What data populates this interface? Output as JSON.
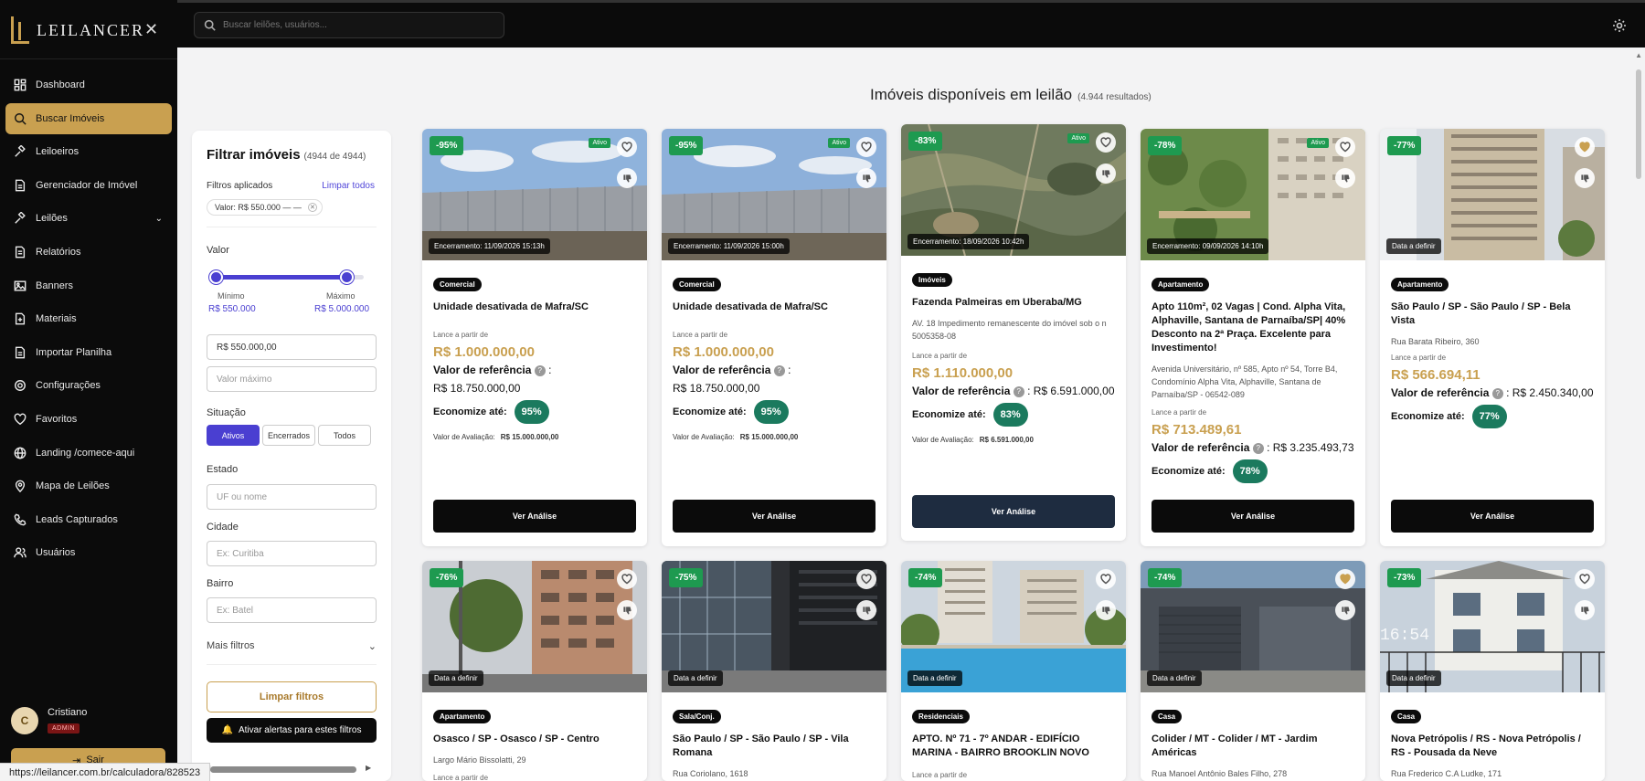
{
  "app": {
    "logo_text": "LEILANCER"
  },
  "nav": {
    "items": [
      {
        "label": "Dashboard"
      },
      {
        "label": "Buscar Imóveis"
      },
      {
        "label": "Leiloeiros"
      },
      {
        "label": "Gerenciador de Imóvel"
      },
      {
        "label": "Leilões"
      },
      {
        "label": "Relatórios"
      },
      {
        "label": "Banners"
      },
      {
        "label": "Materiais"
      },
      {
        "label": "Importar Planilha"
      },
      {
        "label": "Configurações"
      },
      {
        "label": "Favoritos"
      },
      {
        "label": "Landing /comece-aqui"
      },
      {
        "label": "Mapa de Leilões"
      },
      {
        "label": "Leads Capturados"
      },
      {
        "label": "Usuários"
      }
    ]
  },
  "user": {
    "initial": "C",
    "name": "Cristiano",
    "role": "ADMIN",
    "logout_label": "Sair"
  },
  "search": {
    "placeholder": "Buscar leilões, usuários..."
  },
  "main": {
    "title": "Imóveis disponíveis em leilão",
    "count": "(4.944 resultados)"
  },
  "filters": {
    "title": "Filtrar imóveis",
    "count": "(4944 de 4944)",
    "applied_label": "Filtros aplicados",
    "clear_all": "Limpar todos",
    "chip": "Valor: R$ 550.000 — —",
    "valor_label": "Valor",
    "min_caption": "Mínimo",
    "max_caption": "Máximo",
    "min_value": "R$ 550.000",
    "max_value": "R$ 5.000.000",
    "min_input": "R$ 550.000,00",
    "max_placeholder": "Valor máximo",
    "situacao_label": "Situação",
    "situacao_options": [
      "Ativos",
      "Encerrados",
      "Todos"
    ],
    "estado_label": "Estado",
    "estado_placeholder": "UF ou nome",
    "cidade_label": "Cidade",
    "cidade_placeholder": "Ex: Curitiba",
    "bairro_label": "Bairro",
    "bairro_placeholder": "Ex: Batel",
    "more_label": "Mais filtros",
    "clear_button": "Limpar filtros",
    "alerts_button": "Ativar alertas para estes filtros"
  },
  "labels": {
    "lance": "Lance a partir de",
    "ref": "Valor de referência",
    "eco": "Economize até:",
    "aval": "Valor de Avaliação:",
    "ver": "Ver Análise",
    "ativo": "Ativo"
  },
  "cards": [
    {
      "discount": "-95%",
      "active": true,
      "closing": "Encerramento: 11/09/2026 15:13h",
      "tag": "Comercial",
      "title": "Unidade desativada de Mafra/SC",
      "address": "",
      "price": "R$ 1.000.000,00",
      "ref_value": "R$ 18.750.000,00",
      "eco": "95%",
      "aval": "R$ 15.000.000,00"
    },
    {
      "discount": "-95%",
      "active": true,
      "closing": "Encerramento: 11/09/2026 15:00h",
      "tag": "Comercial",
      "title": "Unidade desativada de Mafra/SC",
      "address": "",
      "price": "R$ 1.000.000,00",
      "ref_value": "R$ 18.750.000,00",
      "eco": "95%",
      "aval": "R$ 15.000.000,00"
    },
    {
      "discount": "-83%",
      "active": true,
      "closing": "Encerramento: 18/09/2026 10:42h",
      "tag": "Imóveis",
      "title": "Fazenda Palmeiras em Uberaba/MG",
      "address": "AV. 18 Impedimento remanescente do imóvel sob o n 5005358-08",
      "price": "R$ 1.110.000,00",
      "ref_value": "R$ 6.591.000,00",
      "eco": "83%",
      "aval": "R$ 6.591.000,00"
    },
    {
      "discount": "-78%",
      "active": true,
      "closing": "Encerramento: 09/09/2026 14:10h",
      "tag": "Apartamento",
      "title": "Apto 110m², 02 Vagas | Cond. Alpha Vita, Alphaville, Santana de Parnaíba/SP| 40% Desconto na 2ª Praça. Excelente para Investimento!",
      "address": "Avenida Universitário, nº 585, Apto nº 54, Torre B4, Condomínio Alpha Vita, Alphaville, Santana de Parnaíba/SP - 06542-089",
      "price": "R$ 713.489,61",
      "ref_value": "R$ 3.235.493,73",
      "eco": "78%",
      "aval": ""
    },
    {
      "discount": "-77%",
      "active": false,
      "closing": "Data a definir",
      "tag": "Apartamento",
      "title": "São Paulo / SP - São Paulo / SP - Bela Vista",
      "address": "Rua Barata Ribeiro, 360",
      "price": "R$ 566.694,11",
      "ref_value": "R$ 2.450.340,00",
      "eco": "77%",
      "aval": ""
    },
    {
      "discount": "-76%",
      "closing": "Data a definir",
      "tag": "Apartamento",
      "title": "Osasco / SP - Osasco / SP - Centro",
      "address": "Largo Mário Bissolatti, 29"
    },
    {
      "discount": "-75%",
      "closing": "Data a definir",
      "tag": "Sala/Conj.",
      "title": "São Paulo / SP - São Paulo / SP - Vila Romana",
      "address": "Rua Coriolano, 1618"
    },
    {
      "discount": "-74%",
      "closing": "Data a definir",
      "tag": "Residenciais",
      "title": "APTO. Nº 71 - 7º ANDAR - EDIFÍCIO MARINA - BAIRRO BROOKLIN NOVO",
      "address": ""
    },
    {
      "discount": "-74%",
      "closing": "Data a definir",
      "tag": "Casa",
      "title": "Colider / MT - Colider / MT - Jardim Américas",
      "address": "Rua Manoel Antônio Bales Filho, 278"
    },
    {
      "discount": "-73%",
      "closing": "Data a definir",
      "tag": "Casa",
      "title": "Nova Petrópolis / RS - Nova Petrópolis / RS - Pousada da Neve",
      "address": "Rua Frederico C.A Ludke, 171",
      "overlay": "16:54"
    }
  ],
  "status": {
    "url": "https://leilancer.com.br/calculadora/828523"
  },
  "colors": {
    "gold": "#c9a050",
    "green": "#1e9a50",
    "purple": "#4a3fd1",
    "teal": "#1b7a5e"
  }
}
